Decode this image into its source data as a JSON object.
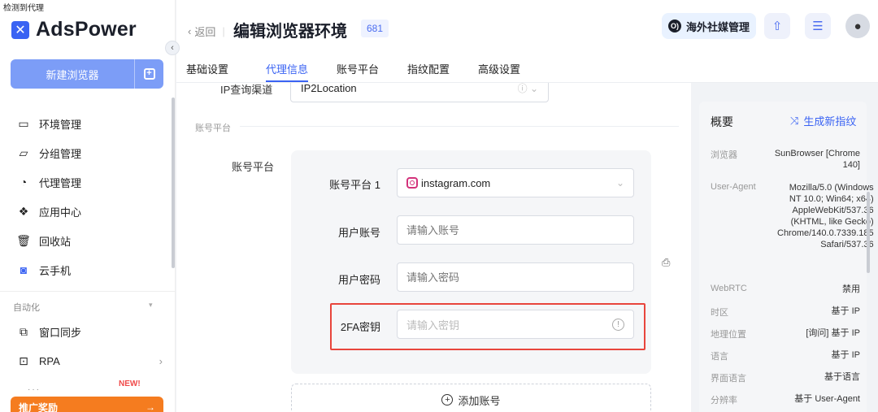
{
  "topstrip": "检测到代理",
  "app": {
    "name": "AdsPower",
    "logo_glyph": "✕"
  },
  "sidebar": {
    "new_browser_label": "新建浏览器",
    "items": [
      {
        "label": "环境管理",
        "icon": "browser-window-icon",
        "glyph": "▭"
      },
      {
        "label": "分组管理",
        "icon": "folder-icon",
        "glyph": "▱"
      },
      {
        "label": "代理管理",
        "icon": "proxy-icon",
        "glyph": "◔"
      },
      {
        "label": "应用中心",
        "icon": "puzzle-icon",
        "glyph": "❖"
      },
      {
        "label": "回收站",
        "icon": "trash-icon",
        "glyph": "🗑"
      },
      {
        "label": "云手机",
        "icon": "cloud-phone-icon",
        "glyph": "◙"
      }
    ],
    "automation_title": "自动化",
    "automation_items": [
      {
        "label": "窗口同步",
        "icon": "window-sync-icon",
        "glyph": "⧉"
      },
      {
        "label": "RPA",
        "icon": "rpa-icon",
        "glyph": "⊡"
      }
    ],
    "new_badge": "NEW!",
    "promo_label": "推广奖励",
    "promo_arrow": "→"
  },
  "header": {
    "back_label": "返回",
    "title": "编辑浏览器环境",
    "id_badge": "681",
    "social_label": "海外社媒管理",
    "social_glyph": "O)"
  },
  "tabs": [
    {
      "label": "基础设置",
      "active": false
    },
    {
      "label": "代理信息",
      "active": true
    },
    {
      "label": "账号平台",
      "active": false
    },
    {
      "label": "指纹配置",
      "active": false
    },
    {
      "label": "高级设置",
      "active": false
    }
  ],
  "form": {
    "ip_query_label": "IP查询渠道",
    "ip_query_value": "IP2Location",
    "section_title": "账号平台",
    "account_platform_label": "账号平台",
    "platform1_label": "账号平台 1",
    "platform1_value": "instagram.com",
    "username_label": "用户账号",
    "username_placeholder": "请输入账号",
    "password_label": "用户密码",
    "password_placeholder": "请输入密码",
    "twofa_label": "2FA密钥",
    "twofa_placeholder": "请输入密钥",
    "add_account_label": "添加账号"
  },
  "overview": {
    "title": "概要",
    "generate_label": "生成新指纹",
    "rows": [
      {
        "key": "浏览器",
        "value": "SunBrowser [Chrome 140]"
      },
      {
        "key": "User-Agent",
        "value": "Mozilla/5.0 (Windows NT 10.0; Win64; x64) AppleWebKit/537.36 (KHTML, like Gecko) Chrome/140.0.7339.185 Safari/537.36"
      },
      {
        "key": "WebRTC",
        "value": "禁用"
      },
      {
        "key": "时区",
        "value": "基于 IP"
      },
      {
        "key": "地理位置",
        "value": "[询问] 基于 IP"
      },
      {
        "key": "语言",
        "value": "基于 IP"
      },
      {
        "key": "界面语言",
        "value": "基于语言"
      },
      {
        "key": "分辨率",
        "value": "基于 User-Agent"
      }
    ]
  },
  "colors": {
    "accent": "#3a63f3",
    "highlight": "#e8453c",
    "promo": "#f57c1f"
  }
}
